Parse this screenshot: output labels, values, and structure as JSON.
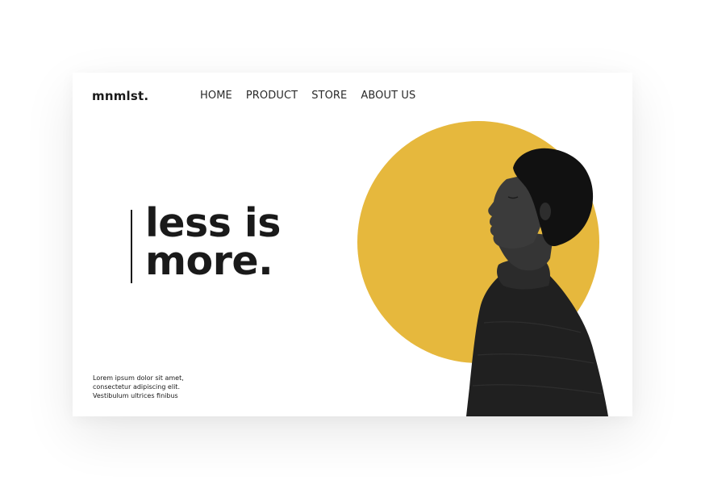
{
  "brand": {
    "logo": "mnmlst."
  },
  "nav": {
    "items": [
      "HOME",
      "PRODUCT",
      "STORE",
      "ABOUT US"
    ]
  },
  "hero": {
    "headline_line1": "less is",
    "headline_line2": "more.",
    "body_lines": [
      "Lorem ipsum dolor sit amet,",
      "consectetur adipiscing elit.",
      "Vestibulum ultrices finibus"
    ],
    "image_icon": "person-profile-photo"
  },
  "colors": {
    "accent": "#E6B83D",
    "text": "#1A1A1A",
    "background": "#FFFFFF"
  }
}
